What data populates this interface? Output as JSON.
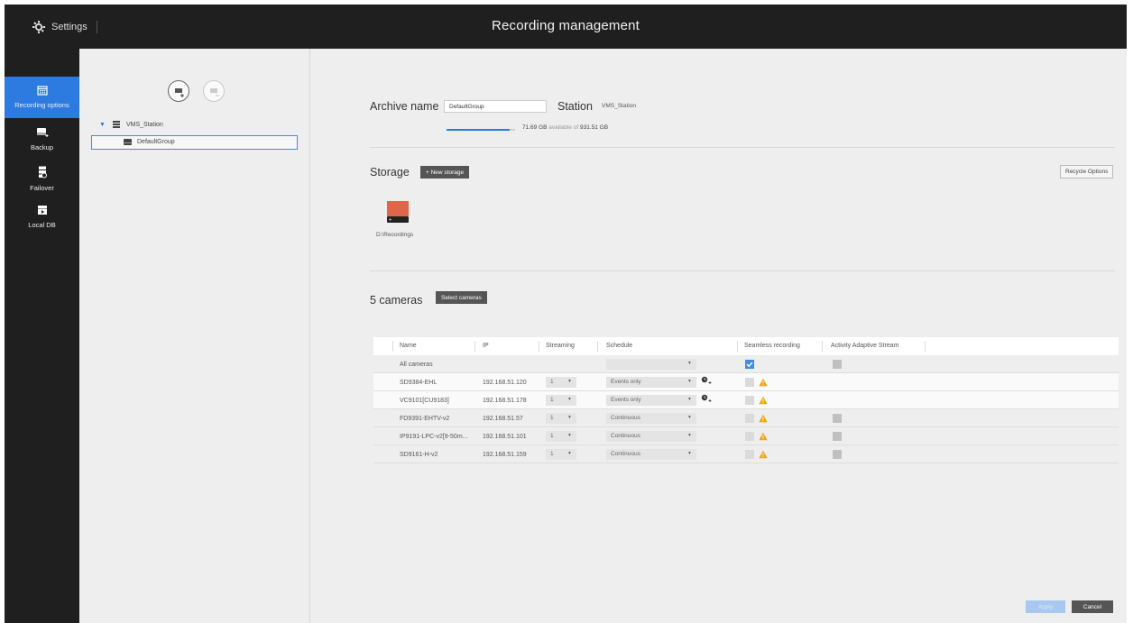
{
  "header": {
    "settings_label": "Settings",
    "title": "Recording management"
  },
  "sidebar": {
    "items": [
      {
        "label": "Recording options",
        "icon": "calendar-icon",
        "active": true
      },
      {
        "label": "Backup",
        "icon": "backup-icon"
      },
      {
        "label": "Failover",
        "icon": "failover-icon"
      },
      {
        "label": "Local DB",
        "icon": "local-db-icon"
      }
    ]
  },
  "tree": {
    "station": "VMS_Station",
    "group": "DefaultGroup"
  },
  "archive": {
    "name_label": "Archive name",
    "name_value": "DefaultGroup",
    "station_label": "Station",
    "station_value": "VMS_Station",
    "available_gb": "71.69 GB",
    "available_text": "available of",
    "total_gb": "931.51 GB",
    "usage_fraction": 0.92
  },
  "storage": {
    "label": "Storage",
    "new_button": "+  New storage",
    "recycle_button": "Recycle Options",
    "path": "D:\\Recordings",
    "drive_color": "#e0664a"
  },
  "cameras": {
    "count_label": "5 cameras",
    "select_button": "Select cameras",
    "columns": [
      "Name",
      "IP",
      "Streaming",
      "Schedule",
      "Seamless recording",
      "Activity Adaptive Stream"
    ],
    "all_label": "All cameras",
    "rows": [
      {
        "name": "SD9384-EHL",
        "ip": "192.168.51.120",
        "stream": "1",
        "schedule": "Events only"
      },
      {
        "name": "VC9101[CU9183]",
        "ip": "192.168.51.178",
        "stream": "1",
        "schedule": "Events only"
      },
      {
        "name": "FD9391-EHTV-v2",
        "ip": "192.168.51.57",
        "stream": "1",
        "schedule": "Continuous"
      },
      {
        "name": "IP9191-LPC-v2[9-50m...",
        "ip": "192.168.51.101",
        "stream": "1",
        "schedule": "Continuous"
      },
      {
        "name": "SD9161-H-v2",
        "ip": "192.168.51.159",
        "stream": "1",
        "schedule": "Continuous"
      }
    ]
  },
  "footer": {
    "apply": "Apply",
    "cancel": "Cancel"
  },
  "colors": {
    "accent": "#2d7be1",
    "warning": "#f0a30a"
  }
}
